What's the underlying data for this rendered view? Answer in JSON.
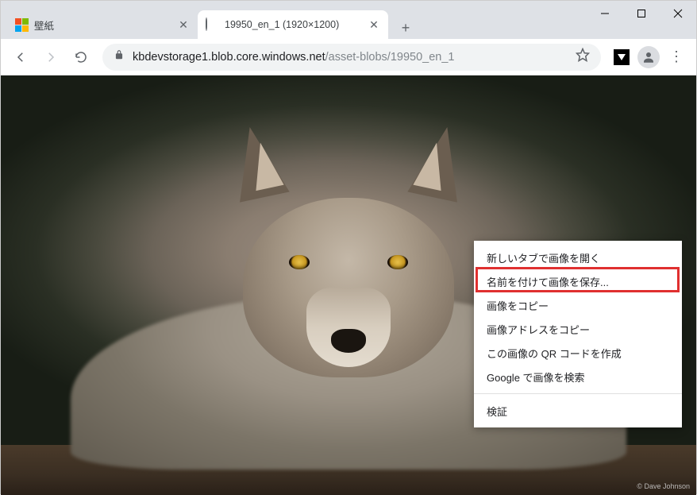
{
  "tabs": [
    {
      "title": "壁紙",
      "favicon": "ms-logo"
    },
    {
      "title": "19950_en_1 (1920×1200)",
      "favicon": "globe"
    }
  ],
  "active_tab_index": 1,
  "url": {
    "host": "kbdevstorage1.blob.core.windows.net",
    "path": "/asset-blobs/19950_en_1"
  },
  "watermark": "© Dave Johnson",
  "context_menu": {
    "items": [
      "新しいタブで画像を開く",
      "名前を付けて画像を保存...",
      "画像をコピー",
      "画像アドレスをコピー",
      "この画像の QR コードを作成",
      "Google で画像を検索"
    ],
    "sep_after_index": 5,
    "last_item": "検証",
    "highlighted_index": 1
  }
}
